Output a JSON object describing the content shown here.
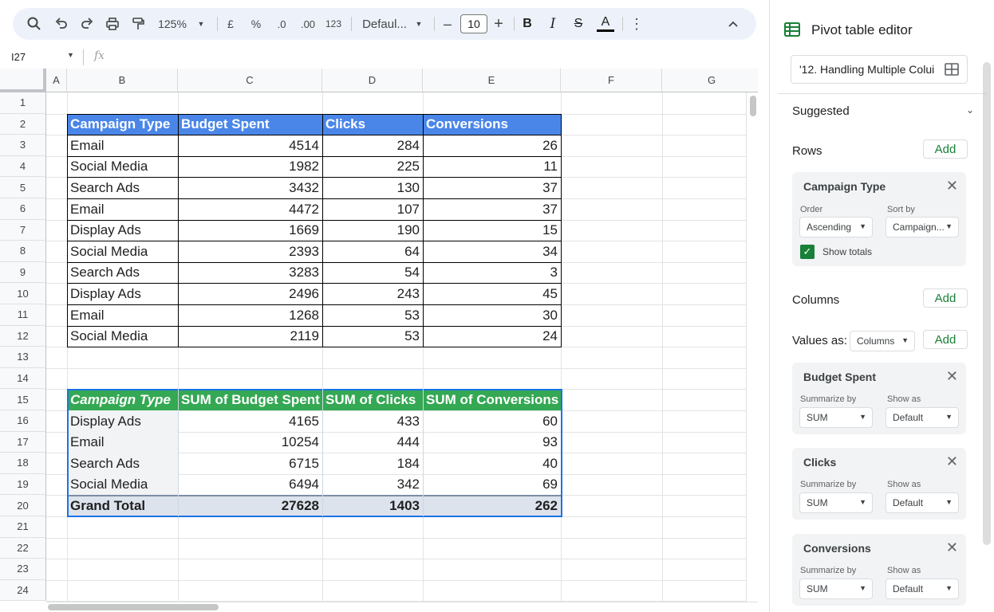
{
  "toolbar": {
    "zoom": "125%",
    "currency_symbol": "£",
    "percent_symbol": "%",
    "decrease_decimals": ".0",
    "increase_decimals": ".00",
    "number_format": "123",
    "font_name": "Defaul...",
    "minus": "–",
    "font_size": "10",
    "plus": "+",
    "bold": "B",
    "italic": "I",
    "strikethrough": "S",
    "text_color": "A"
  },
  "formula_bar": {
    "cell_ref": "I27",
    "fx": "fx"
  },
  "columns": [
    "A",
    "B",
    "C",
    "D",
    "E",
    "F",
    "G"
  ],
  "rows": [
    "1",
    "2",
    "3",
    "4",
    "5",
    "6",
    "7",
    "8",
    "9",
    "10",
    "11",
    "12",
    "13",
    "14",
    "15",
    "16",
    "17",
    "18",
    "19",
    "20",
    "21",
    "22",
    "23",
    "24"
  ],
  "table1": {
    "headers": [
      "Campaign Type",
      "Budget Spent",
      "Clicks",
      "Conversions"
    ],
    "rows": [
      [
        "Email",
        "4514",
        "284",
        "26"
      ],
      [
        "Social Media",
        "1982",
        "225",
        "11"
      ],
      [
        "Search Ads",
        "3432",
        "130",
        "37"
      ],
      [
        "Email",
        "4472",
        "107",
        "37"
      ],
      [
        "Display Ads",
        "1669",
        "190",
        "15"
      ],
      [
        "Social Media",
        "2393",
        "64",
        "34"
      ],
      [
        "Search Ads",
        "3283",
        "54",
        "3"
      ],
      [
        "Display Ads",
        "2496",
        "243",
        "45"
      ],
      [
        "Email",
        "1268",
        "53",
        "30"
      ],
      [
        "Social Media",
        "2119",
        "53",
        "24"
      ]
    ]
  },
  "pivot": {
    "headers": [
      "Campaign Type",
      "SUM of Budget Spent",
      "SUM of Clicks",
      "SUM of Conversions"
    ],
    "rows": [
      [
        "Display Ads",
        "4165",
        "433",
        "60"
      ],
      [
        "Email",
        "10254",
        "444",
        "93"
      ],
      [
        "Search Ads",
        "6715",
        "184",
        "40"
      ],
      [
        "Social Media",
        "6494",
        "342",
        "69"
      ]
    ],
    "total": [
      "Grand Total",
      "27628",
      "1403",
      "262"
    ]
  },
  "panel": {
    "title": "Pivot table editor",
    "range": "'12. Handling Multiple Colui",
    "suggested": "Suggested",
    "rows_label": "Rows",
    "add": "Add",
    "columns_label": "Columns",
    "values_as_label": "Values as:",
    "values_as_value": "Columns",
    "row_card": {
      "title": "Campaign Type",
      "order_label": "Order",
      "order_value": "Ascending",
      "sort_label": "Sort by",
      "sort_value": "Campaign...",
      "show_totals": "Show totals"
    },
    "value_cards": [
      {
        "title": "Budget Spent",
        "summarize_label": "Summarize by",
        "summarize_value": "SUM",
        "show_label": "Show as",
        "show_value": "Default"
      },
      {
        "title": "Clicks",
        "summarize_label": "Summarize by",
        "summarize_value": "SUM",
        "show_label": "Show as",
        "show_value": "Default"
      },
      {
        "title": "Conversions",
        "summarize_label": "Summarize by",
        "summarize_value": "SUM",
        "show_label": "Show as",
        "show_value": "Default"
      }
    ]
  },
  "colors": {
    "table_header": "#4a86e8",
    "pivot_header": "#34a853",
    "pivot_total": "#dde3ec",
    "accent_green": "#188038"
  }
}
